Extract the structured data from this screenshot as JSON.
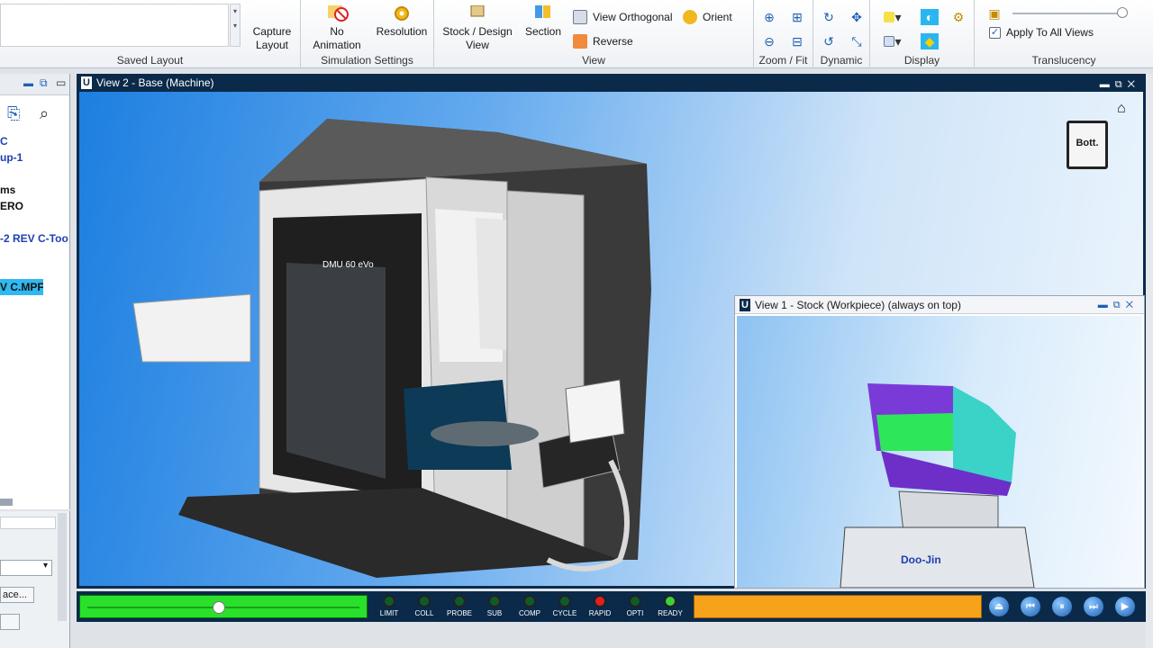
{
  "ribbon": {
    "saved_layout": {
      "label": "Saved Layout",
      "capture_label": "Capture Layout"
    },
    "simulation_settings": {
      "label": "Simulation Settings",
      "no_animation": "No Animation",
      "resolution": "Resolution"
    },
    "view": {
      "label": "View",
      "stock_design": "Stock / Design View",
      "section": "Section",
      "view_orthogonal": "View Orthogonal",
      "reverse": "Reverse",
      "orient": "Orient"
    },
    "zoom_fit": {
      "label": "Zoom / Fit"
    },
    "dynamic": {
      "label": "Dynamic"
    },
    "display": {
      "label": "Display"
    },
    "translucency": {
      "label": "Translucency",
      "apply_all": "Apply To All Views",
      "apply_all_checked": true
    }
  },
  "left_panel": {
    "tree_items": [
      "C",
      "up-1",
      "",
      "ms",
      "ERO",
      "",
      "-2 REV C-Too",
      "",
      "",
      "V C.MPF"
    ],
    "selected_index": 9,
    "button_label": "ace..."
  },
  "main_view": {
    "title": "View 2 - Base (Machine)",
    "machine_label": "DMU 60 eVo",
    "orientation_cube_label": "Bott."
  },
  "inset_view": {
    "title": "View 1 - Stock (Workpiece) (always on top)",
    "vise_label": "Doo-Jin"
  },
  "status": {
    "progress": 0.48,
    "lamps": [
      {
        "label": "LIMIT",
        "color": "#0f5a2a"
      },
      {
        "label": "COLL",
        "color": "#0f5a2a"
      },
      {
        "label": "PROBE",
        "color": "#0f5a2a"
      },
      {
        "label": "SUB",
        "color": "#0f5a2a"
      },
      {
        "label": "COMP",
        "color": "#0f5a2a"
      },
      {
        "label": "CYCLE",
        "color": "#0f5a2a"
      },
      {
        "label": "RAPID",
        "color": "#e02020"
      },
      {
        "label": "OPTI",
        "color": "#0f5a2a"
      },
      {
        "label": "READY",
        "color": "#3ad13a"
      }
    ],
    "controls": [
      {
        "name": "eject-icon",
        "glyph": "⏏"
      },
      {
        "name": "rewind-icon",
        "glyph": "⏮"
      },
      {
        "name": "pause-icon",
        "glyph": "⏸"
      },
      {
        "name": "step-forward-icon",
        "glyph": "⏭"
      },
      {
        "name": "play-icon",
        "glyph": "▶"
      }
    ]
  }
}
